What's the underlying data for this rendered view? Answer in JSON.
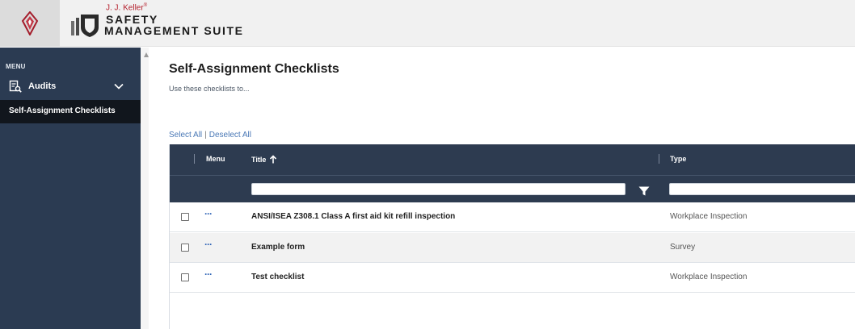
{
  "header": {
    "brand_top": "J. J. Keller",
    "brand_registered": "®",
    "brand_line1": "SAFETY",
    "brand_line2": "MANAGEMENT SUITE"
  },
  "sidebar": {
    "menu_label": "MENU",
    "items": [
      {
        "label": "Audits",
        "icon": "audit-icon",
        "expandable": true
      },
      {
        "label": "Self-Assignment Checklists",
        "active": true
      }
    ]
  },
  "main": {
    "title": "Self-Assignment Checklists",
    "subtitle": "Use these checklists to...",
    "select_all": "Select All",
    "separator": "|",
    "deselect_all": "Deselect All"
  },
  "grid": {
    "columns": {
      "menu": "Menu",
      "title": "Title",
      "type": "Type"
    },
    "sort": {
      "column": "title",
      "direction": "ascending"
    },
    "filters": {
      "title": "",
      "type": ""
    },
    "rows": [
      {
        "menu": "···",
        "title": "ANSI/ISEA Z308.1 Class A first aid kit refill inspection",
        "type": "Workplace Inspection",
        "checked": false
      },
      {
        "menu": "···",
        "title": "Example form",
        "type": "Survey",
        "checked": false
      },
      {
        "menu": "···",
        "title": "Test checklist",
        "type": "Workplace Inspection",
        "checked": false
      }
    ]
  },
  "colors": {
    "sidebar": "#2b3b52",
    "active_nav": "#11161d",
    "grid_header": "#2d3b50",
    "link": "#4a78b6",
    "brand_red": "#b41e2b"
  }
}
